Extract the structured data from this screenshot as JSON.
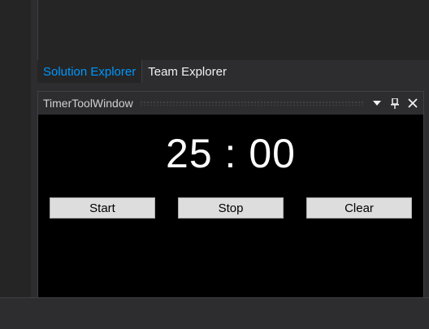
{
  "tabs": [
    {
      "label": "Solution Explorer",
      "active": true
    },
    {
      "label": "Team Explorer",
      "active": false
    }
  ],
  "tool_window": {
    "title": "TimerToolWindow",
    "icons": [
      "dropdown-icon",
      "pin-icon",
      "close-icon"
    ]
  },
  "timer": {
    "display": "25 : 00"
  },
  "buttons": {
    "start": "Start",
    "stop": "Stop",
    "clear": "Clear"
  },
  "colors": {
    "accent": "#0097fb",
    "background": "#2d2d30",
    "panel": "#000000"
  }
}
